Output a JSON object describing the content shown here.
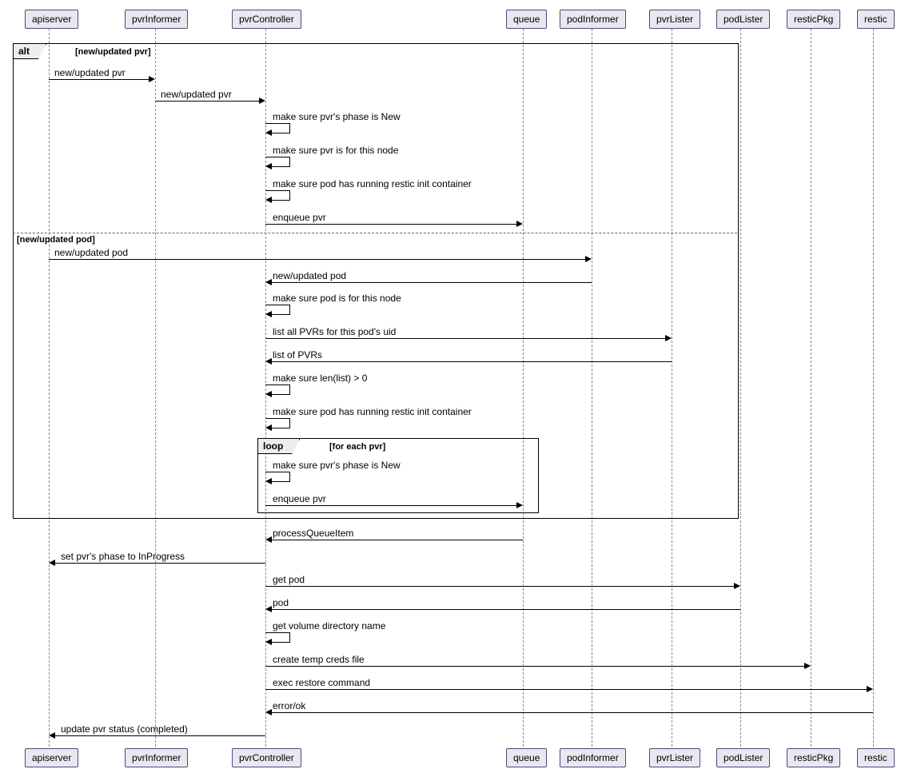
{
  "chart_data": {
    "type": "sequence_diagram",
    "participants": [
      "apiserver",
      "pvrInformer",
      "pvrController",
      "queue",
      "podInformer",
      "pvrLister",
      "podLister",
      "resticPkg",
      "restic"
    ],
    "fragments": [
      {
        "type": "alt",
        "guards": [
          "[new/updated pvr]",
          "[new/updated pod]"
        ],
        "alt1": [
          {
            "from": "apiserver",
            "to": "pvrInformer",
            "label": "new/updated pvr"
          },
          {
            "from": "pvrInformer",
            "to": "pvrController",
            "label": "new/updated pvr"
          },
          {
            "self": "pvrController",
            "label": "make sure pvr's phase is New"
          },
          {
            "self": "pvrController",
            "label": "make sure pvr is for this node"
          },
          {
            "self": "pvrController",
            "label": "make sure pod has running restic init container"
          },
          {
            "from": "pvrController",
            "to": "queue",
            "label": "enqueue pvr"
          }
        ],
        "alt2": [
          {
            "from": "apiserver",
            "to": "podInformer",
            "label": "new/updated pod"
          },
          {
            "from": "podInformer",
            "to": "pvrController",
            "label": "new/updated pod"
          },
          {
            "self": "pvrController",
            "label": "make sure pod is for this node"
          },
          {
            "from": "pvrController",
            "to": "pvrLister",
            "label": "list all PVRs for this pod's uid"
          },
          {
            "from": "pvrLister",
            "to": "pvrController",
            "label": "list of PVRs"
          },
          {
            "self": "pvrController",
            "label": "make sure len(list) > 0"
          },
          {
            "self": "pvrController",
            "label": "make sure pod has running restic init container"
          },
          {
            "type": "loop",
            "guard": "[for each pvr]",
            "body": [
              {
                "self": "pvrController",
                "label": "make sure pvr's phase is New"
              },
              {
                "from": "pvrController",
                "to": "queue",
                "label": "enqueue pvr"
              }
            ]
          }
        ]
      }
    ],
    "after": [
      {
        "from": "queue",
        "to": "pvrController",
        "label": "processQueueItem"
      },
      {
        "from": "pvrController",
        "to": "apiserver",
        "label": "set pvr's phase to InProgress"
      },
      {
        "from": "pvrController",
        "to": "podLister",
        "label": "get pod"
      },
      {
        "from": "podLister",
        "to": "pvrController",
        "label": "pod"
      },
      {
        "self": "pvrController",
        "label": "get volume directory name"
      },
      {
        "from": "pvrController",
        "to": "resticPkg",
        "label": "create temp creds file"
      },
      {
        "from": "pvrController",
        "to": "restic",
        "label": "exec restore command"
      },
      {
        "from": "restic",
        "to": "pvrController",
        "label": "error/ok"
      },
      {
        "from": "pvrController",
        "to": "apiserver",
        "label": "update pvr status (completed)"
      }
    ]
  },
  "participants": {
    "apiserver": "apiserver",
    "pvrInformer": "pvrInformer",
    "pvrController": "pvrController",
    "queue": "queue",
    "podInformer": "podInformer",
    "pvrLister": "pvrLister",
    "podLister": "podLister",
    "resticPkg": "resticPkg",
    "restic": "restic"
  },
  "frames": {
    "alt_label": "alt",
    "alt_guard1": "[new/updated pvr]",
    "alt_guard2": "[new/updated pod]",
    "loop_label": "loop",
    "loop_guard": "[for each pvr]"
  },
  "messages": {
    "m1": "new/updated pvr",
    "m2": "new/updated pvr",
    "m3": "make sure pvr's phase is New",
    "m4": "make sure pvr is for this node",
    "m5": "make sure pod has running restic init container",
    "m6": "enqueue pvr",
    "m7": "new/updated pod",
    "m8": "new/updated pod",
    "m9": "make sure pod is for this node",
    "m10": "list all PVRs for this pod's uid",
    "m11": "list of PVRs",
    "m12": "make sure len(list) > 0",
    "m13": "make sure pod has running restic init container",
    "m14": "make sure pvr's phase is New",
    "m15": "enqueue pvr",
    "m16": "processQueueItem",
    "m17": "set pvr's phase to InProgress",
    "m18": "get pod",
    "m19": "pod",
    "m20": "get volume directory name",
    "m21": "create temp creds file",
    "m22": "exec restore command",
    "m23": "error/ok",
    "m24": "update pvr status (completed)"
  }
}
